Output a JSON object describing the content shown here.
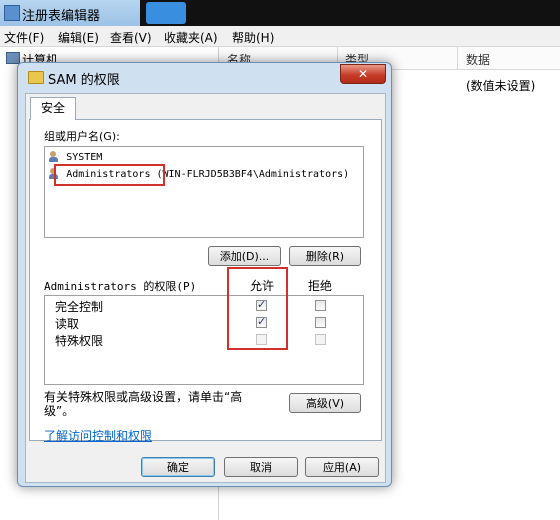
{
  "background_app": {
    "title": "注册表编辑器",
    "menu": [
      "文件(F)",
      "编辑(E)",
      "查看(V)",
      "收藏夹(A)",
      "帮助(H)"
    ],
    "tree_root": "计算机",
    "columns": [
      "名称",
      "类型",
      "数据"
    ],
    "data_value": "(数值未设置)"
  },
  "dialog": {
    "title": "SAM 的权限",
    "close_label": "✕",
    "tab": "安全",
    "group_label": "组或用户名(G):",
    "users": [
      "SYSTEM",
      "Administrators (WIN-FLRJD5B3BF4\\Administrators)"
    ],
    "add_button": "添加(D)...",
    "remove_button": "删除(R)",
    "perm_header": "Administrators 的权限(P)",
    "allow_header": "允许",
    "deny_header": "拒绝",
    "permissions": [
      {
        "name": "完全控制",
        "allow": true,
        "deny": false
      },
      {
        "name": "读取",
        "allow": true,
        "deny": false
      },
      {
        "name": "特殊权限",
        "allow": false,
        "deny": false
      }
    ],
    "advanced_text": "有关特殊权限或高级设置，请单击“高级”。",
    "advanced_button": "高级(V)",
    "link_text": "了解访问控制和权限",
    "ok_button": "确定",
    "cancel_button": "取消",
    "apply_button": "应用(A)"
  },
  "colors": {
    "annotation_red": "#d0312d",
    "link_blue": "#0066cc"
  }
}
